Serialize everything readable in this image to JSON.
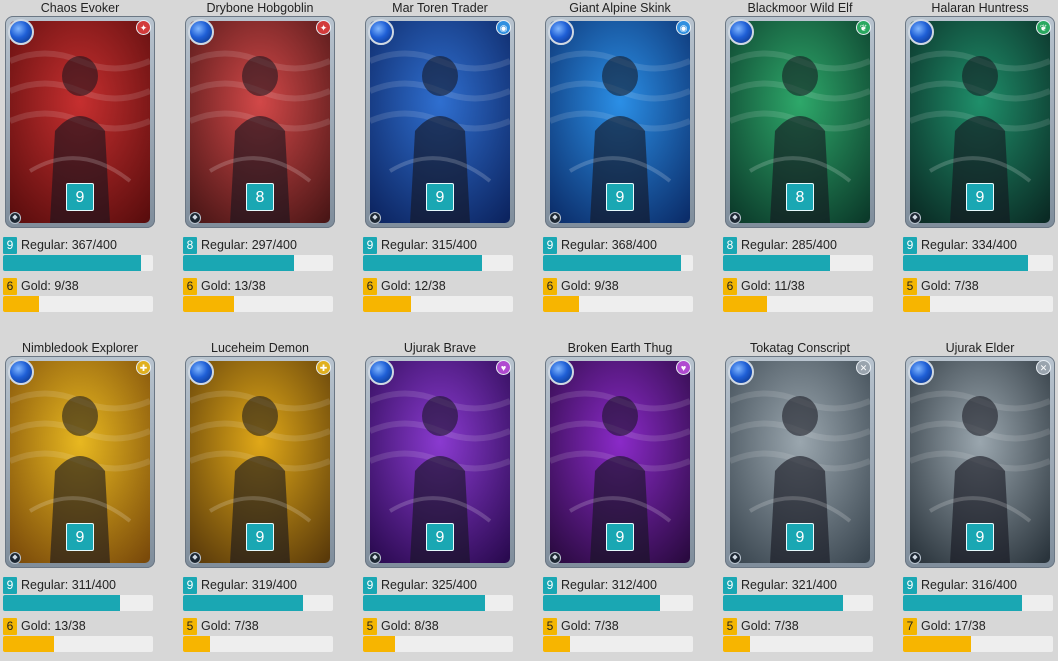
{
  "labels": {
    "regular_prefix": "Regular: ",
    "gold_prefix": "Gold: "
  },
  "cards": [
    {
      "name": "Chaos Evoker",
      "level": "9",
      "element": "fire",
      "element_color": "#d23b3b",
      "art_colors": [
        "#c62f2f",
        "#5a0d0d"
      ],
      "regular_level": "9",
      "regular": "367/400",
      "regular_progress": 0.9175,
      "gold_level": "6",
      "gold": "9/38",
      "gold_progress": 0.24
    },
    {
      "name": "Drybone Hobgoblin",
      "level": "8",
      "element": "fire",
      "element_color": "#d23b3b",
      "art_colors": [
        "#d24848",
        "#4a1616"
      ],
      "regular_level": "8",
      "regular": "297/400",
      "regular_progress": 0.7425,
      "gold_level": "6",
      "gold": "13/38",
      "gold_progress": 0.34
    },
    {
      "name": "Mar Toren Trader",
      "level": "9",
      "element": "water",
      "element_color": "#2f8fe0",
      "art_colors": [
        "#2f6fd0",
        "#0c2460"
      ],
      "regular_level": "9",
      "regular": "315/400",
      "regular_progress": 0.79,
      "gold_level": "6",
      "gold": "12/38",
      "gold_progress": 0.32
    },
    {
      "name": "Giant Alpine Skink",
      "level": "9",
      "element": "water",
      "element_color": "#2f8fe0",
      "art_colors": [
        "#2b8fe6",
        "#0b2d6a"
      ],
      "regular_level": "9",
      "regular": "368/400",
      "regular_progress": 0.92,
      "gold_level": "6",
      "gold": "9/38",
      "gold_progress": 0.24
    },
    {
      "name": "Blackmoor Wild Elf",
      "level": "8",
      "element": "earth",
      "element_color": "#2aa860",
      "art_colors": [
        "#2ea86a",
        "#0b3a2a"
      ],
      "regular_level": "8",
      "regular": "285/400",
      "regular_progress": 0.7125,
      "gold_level": "6",
      "gold": "11/38",
      "gold_progress": 0.29
    },
    {
      "name": "Halaran Huntress",
      "level": "9",
      "element": "earth",
      "element_color": "#2aa860",
      "art_colors": [
        "#1f8f6a",
        "#0a2a24"
      ],
      "regular_level": "9",
      "regular": "334/400",
      "regular_progress": 0.835,
      "gold_level": "5",
      "gold": "7/38",
      "gold_progress": 0.18
    },
    {
      "name": "Nimbledook Explorer",
      "level": "9",
      "element": "life",
      "element_color": "#e0b020",
      "art_colors": [
        "#e8b820",
        "#7a4a0a"
      ],
      "regular_level": "9",
      "regular": "311/400",
      "regular_progress": 0.78,
      "gold_level": "6",
      "gold": "13/38",
      "gold_progress": 0.34
    },
    {
      "name": "Luceheim Demon",
      "level": "9",
      "element": "life",
      "element_color": "#e0b020",
      "art_colors": [
        "#e0a818",
        "#5a3a0a"
      ],
      "regular_level": "9",
      "regular": "319/400",
      "regular_progress": 0.8,
      "gold_level": "5",
      "gold": "7/38",
      "gold_progress": 0.18
    },
    {
      "name": "Ujurak Brave",
      "level": "9",
      "element": "death",
      "element_color": "#b04ad0",
      "art_colors": [
        "#8a3ad0",
        "#2a0a50"
      ],
      "regular_level": "9",
      "regular": "325/400",
      "regular_progress": 0.81,
      "gold_level": "5",
      "gold": "8/38",
      "gold_progress": 0.21
    },
    {
      "name": "Broken Earth Thug",
      "level": "9",
      "element": "death",
      "element_color": "#b04ad0",
      "art_colors": [
        "#8a2ac8",
        "#2a0a40"
      ],
      "regular_level": "9",
      "regular": "312/400",
      "regular_progress": 0.78,
      "gold_level": "5",
      "gold": "7/38",
      "gold_progress": 0.18
    },
    {
      "name": "Tokatag Conscript",
      "level": "9",
      "element": "neutral",
      "element_color": "#9aa4ae",
      "art_colors": [
        "#9aa6ae",
        "#3a4650"
      ],
      "regular_level": "9",
      "regular": "321/400",
      "regular_progress": 0.8,
      "gold_level": "5",
      "gold": "7/38",
      "gold_progress": 0.18
    },
    {
      "name": "Ujurak Elder",
      "level": "9",
      "element": "neutral",
      "element_color": "#9aa4ae",
      "art_colors": [
        "#9aa6ae",
        "#2a343c"
      ],
      "regular_level": "9",
      "regular": "316/400",
      "regular_progress": 0.79,
      "gold_level": "7",
      "gold": "17/38",
      "gold_progress": 0.45
    }
  ]
}
